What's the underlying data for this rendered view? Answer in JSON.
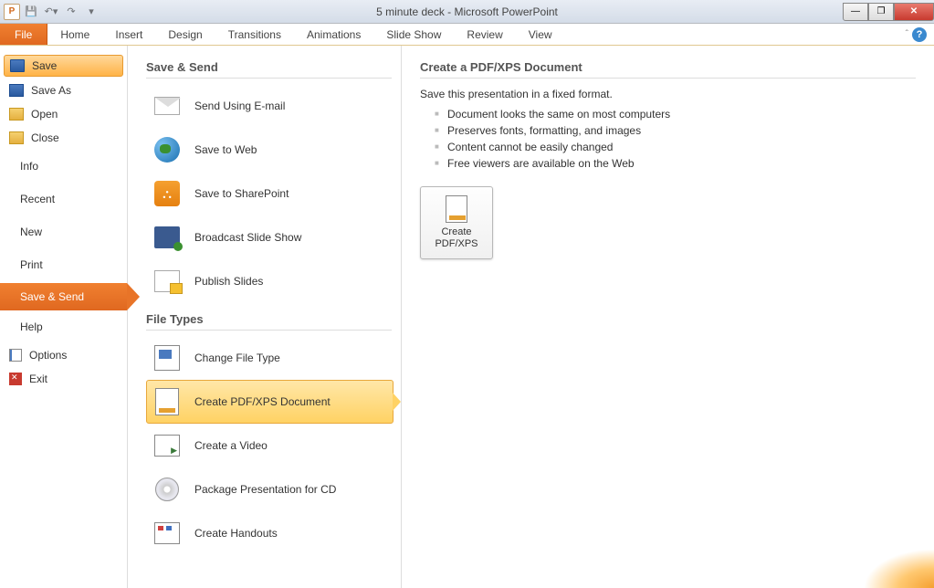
{
  "window": {
    "title": "5 minute deck - Microsoft PowerPoint",
    "app_initial": "P"
  },
  "ribbon": {
    "file": "File",
    "tabs": [
      "Home",
      "Insert",
      "Design",
      "Transitions",
      "Animations",
      "Slide Show",
      "Review",
      "View"
    ]
  },
  "backstage_left": {
    "save": "Save",
    "save_as": "Save As",
    "open": "Open",
    "close": "Close",
    "info": "Info",
    "recent": "Recent",
    "new": "New",
    "print": "Print",
    "save_send": "Save & Send",
    "help": "Help",
    "options": "Options",
    "exit": "Exit"
  },
  "save_send": {
    "heading": "Save & Send",
    "items": [
      "Send Using E-mail",
      "Save to Web",
      "Save to SharePoint",
      "Broadcast Slide Show",
      "Publish Slides"
    ],
    "file_types_heading": "File Types",
    "file_type_items": [
      "Change File Type",
      "Create PDF/XPS Document",
      "Create a Video",
      "Package Presentation for CD",
      "Create Handouts"
    ]
  },
  "detail": {
    "heading": "Create a PDF/XPS Document",
    "desc": "Save this presentation in a fixed format.",
    "bullets": [
      "Document looks the same on most computers",
      "Preserves fonts, formatting, and images",
      "Content cannot be easily changed",
      "Free viewers are available on the Web"
    ],
    "button_label": "Create PDF/XPS"
  }
}
